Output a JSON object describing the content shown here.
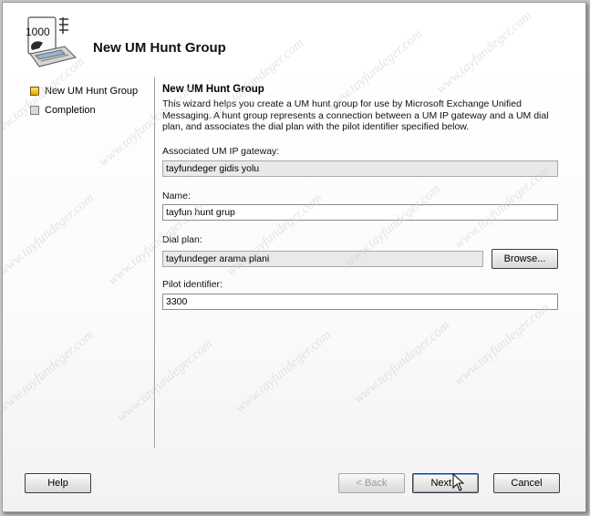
{
  "window": {
    "title": "New UM Hunt Group"
  },
  "header": {
    "title": "New UM Hunt Group",
    "icon": "phone-directory-icon",
    "icon_text": "1000"
  },
  "steps": [
    {
      "label": "New UM Hunt Group",
      "state": "active"
    },
    {
      "label": "Completion",
      "state": "pending"
    }
  ],
  "page": {
    "title": "New UM Hunt Group",
    "description": "This wizard helps you create a UM hunt group for use by Microsoft Exchange Unified Messaging. A hunt group represents a connection between a UM IP gateway and a UM dial plan, and associates the dial plan with the pilot identifier specified below."
  },
  "form": {
    "gateway": {
      "label": "Associated UM IP gateway:",
      "value": "tayfundeger gidis yolu"
    },
    "name": {
      "label": "Name:",
      "value": "tayfun hunt grup"
    },
    "dial_plan": {
      "label": "Dial plan:",
      "value": "tayfundeger arama plani",
      "browse_label": "Browse..."
    },
    "pilot": {
      "label": "Pilot identifier:",
      "value": "3300"
    }
  },
  "footer": {
    "help": "Help",
    "back": "< Back",
    "next": "Next >",
    "cancel": "Cancel"
  },
  "watermark": {
    "text": "www.tayfundeger.com"
  },
  "colors": {
    "active_step": "#f0c020",
    "button_border": "#3c3c3c",
    "window_bg": "#ffffff"
  }
}
